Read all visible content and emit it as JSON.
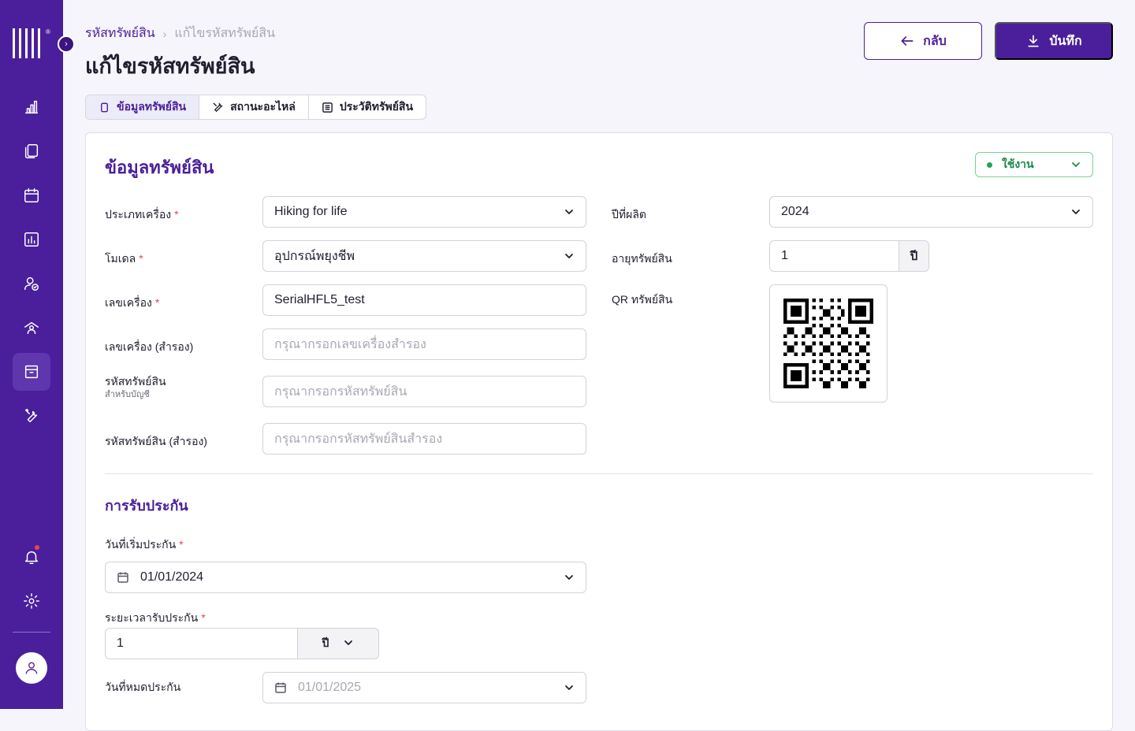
{
  "sidebar": {
    "logo_reg": "®",
    "nav": [
      {
        "icon": "bar-chart-icon",
        "active": false
      },
      {
        "icon": "documents-icon",
        "active": false
      },
      {
        "icon": "calendar-icon",
        "active": false
      },
      {
        "icon": "report-icon",
        "active": false
      },
      {
        "icon": "user-check-icon",
        "active": false
      },
      {
        "icon": "organization-icon",
        "active": false
      },
      {
        "icon": "asset-box-icon",
        "active": true
      },
      {
        "icon": "tools-icon",
        "active": false
      }
    ],
    "bottom": [
      {
        "icon": "bell-icon",
        "has_notification": true
      },
      {
        "icon": "settings-icon"
      }
    ],
    "avatar_icon": "user-icon"
  },
  "breadcrumb": {
    "parent": "รหัสทรัพย์สิน",
    "separator": "›",
    "current": "แก้ไขรหัสทรัพย์สิน"
  },
  "page_title": "แก้ไขรหัสทรัพย์สิน",
  "actions": {
    "back_label": "กลับ",
    "save_label": "บันทึก"
  },
  "tabs": [
    {
      "label": "ข้อมูลทรัพย์สิน",
      "icon": "clipboard-icon",
      "active": true
    },
    {
      "label": "สถานะอะไหล่",
      "icon": "tools-icon",
      "active": false
    },
    {
      "label": "ประวัติทรัพย์สิน",
      "icon": "list-icon",
      "active": false
    }
  ],
  "asset_info": {
    "title": "ข้อมูลทรัพย์สิน",
    "status": {
      "label": "ใช้งาน",
      "color": "#22a35a"
    },
    "machine_type": {
      "label": "ประเภทเครื่อง",
      "value": "Hiking for life"
    },
    "model": {
      "label": "โมเดล",
      "value": "อุปกรณ์พยุงชีพ"
    },
    "serial": {
      "label": "เลขเครื่อง",
      "value": "SerialHFL5_test"
    },
    "serial_backup": {
      "label": "เลขเครื่อง (สำรอง)",
      "placeholder": "กรุณากรอกเลขเครื่องสำรอง"
    },
    "asset_code": {
      "label": "รหัสทรัพย์สิน",
      "sublabel": "สำหรับบัญชี",
      "placeholder": "กรุณากรอกรหัสทรัพย์สิน"
    },
    "asset_code_backup": {
      "label": "รหัสทรัพย์สิน (สำรอง)",
      "placeholder": "กรุณากรอกรหัสทรัพย์สินสำรอง"
    },
    "manufacture_year": {
      "label": "ปีที่ผลิต",
      "value": "2024"
    },
    "asset_age": {
      "label": "อายุทรัพย์สิน",
      "value": "1",
      "unit": "ปี"
    },
    "qr": {
      "label": "QR ทรัพย์สิน"
    }
  },
  "warranty": {
    "title": "การรับประกัน",
    "start_date": {
      "label": "วันที่เริ่มประกัน",
      "value": "01/01/2024"
    },
    "duration": {
      "label": "ระยะเวลารับประกัน",
      "value": "1",
      "unit": "ปี"
    },
    "end_date": {
      "label": "วันที่หมดประกัน",
      "value": "01/01/2025"
    }
  },
  "required_mark": "*",
  "colors": {
    "primary": "#4b1f9b",
    "status_active": "#22a35a",
    "required": "#e5484d"
  }
}
